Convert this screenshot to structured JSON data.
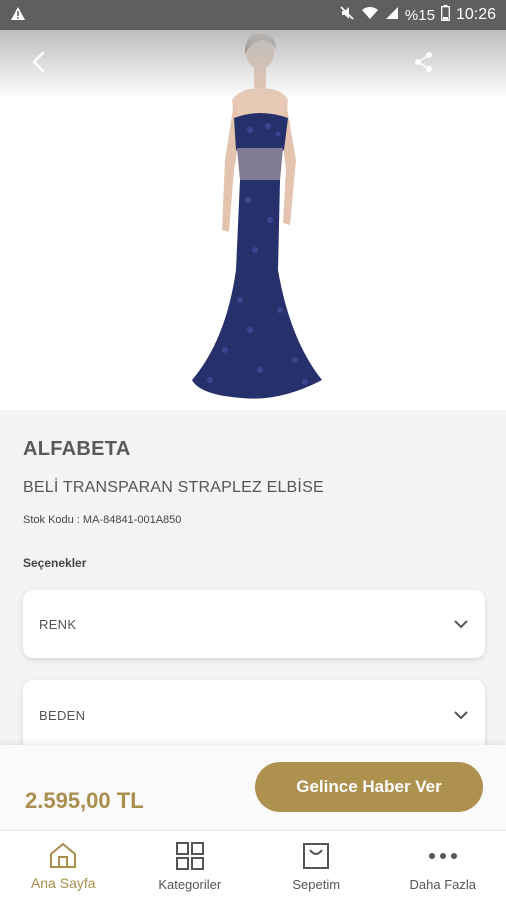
{
  "statusbar": {
    "battery": "%15",
    "time": "10:26",
    "icons": [
      "warning-icon",
      "mute-icon",
      "wifi-icon",
      "signal-icon",
      "battery-icon"
    ]
  },
  "product": {
    "brand": "ALFABETA",
    "name": "BELİ TRANSPARAN STRAPLEZ ELBİSE",
    "stock_code": "Stok Kodu : MA-84841-001A850"
  },
  "options": {
    "title": "Seçenekler",
    "color_label": "RENK",
    "size_label": "BEDEN"
  },
  "purchase": {
    "price": "2.595,00 TL",
    "notify_label": "Gelince Haber Ver"
  },
  "nav": {
    "items": [
      {
        "label": "Ana Sayfa",
        "icon": "home-icon"
      },
      {
        "label": "Kategoriler",
        "icon": "grid-icon"
      },
      {
        "label": "Sepetim",
        "icon": "bag-icon"
      },
      {
        "label": "Daha Fazla",
        "icon": "more-icon"
      }
    ]
  },
  "colors": {
    "accent": "#ae914f",
    "price": "#a98e4c",
    "dress": "#26306a"
  }
}
